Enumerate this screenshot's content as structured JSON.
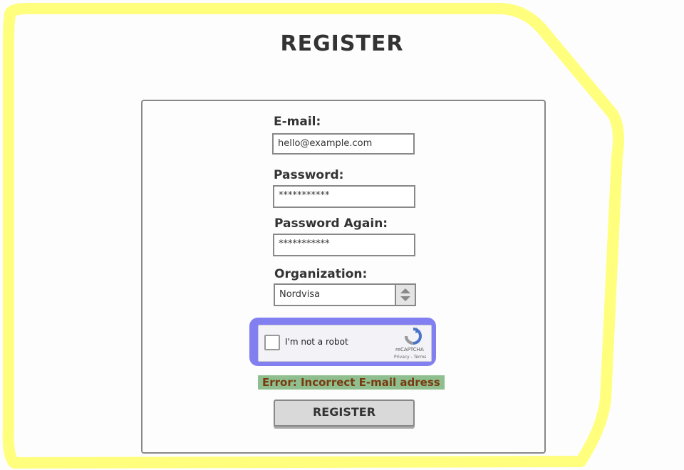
{
  "page": {
    "title": "REGISTER"
  },
  "form": {
    "email": {
      "label": "E-mail:",
      "value": "hello@example.com"
    },
    "password": {
      "label": "Password:",
      "value": "***********"
    },
    "password_again": {
      "label": "Password Again:",
      "value": "***********"
    },
    "organization": {
      "label": "Organization:",
      "value": "Nordvisa"
    },
    "captcha": {
      "label": "I'm not a robot",
      "brand": "reCAPTCHA",
      "links": "Privacy - Terms"
    },
    "error": "Error: Incorrect E-mail adress",
    "submit_label": "REGISTER"
  },
  "colors": {
    "frame_highlight": "#ffff66",
    "captcha_highlight": "#7b78f0",
    "error_highlight": "#8fbf8f",
    "error_text": "#7a3a10"
  }
}
